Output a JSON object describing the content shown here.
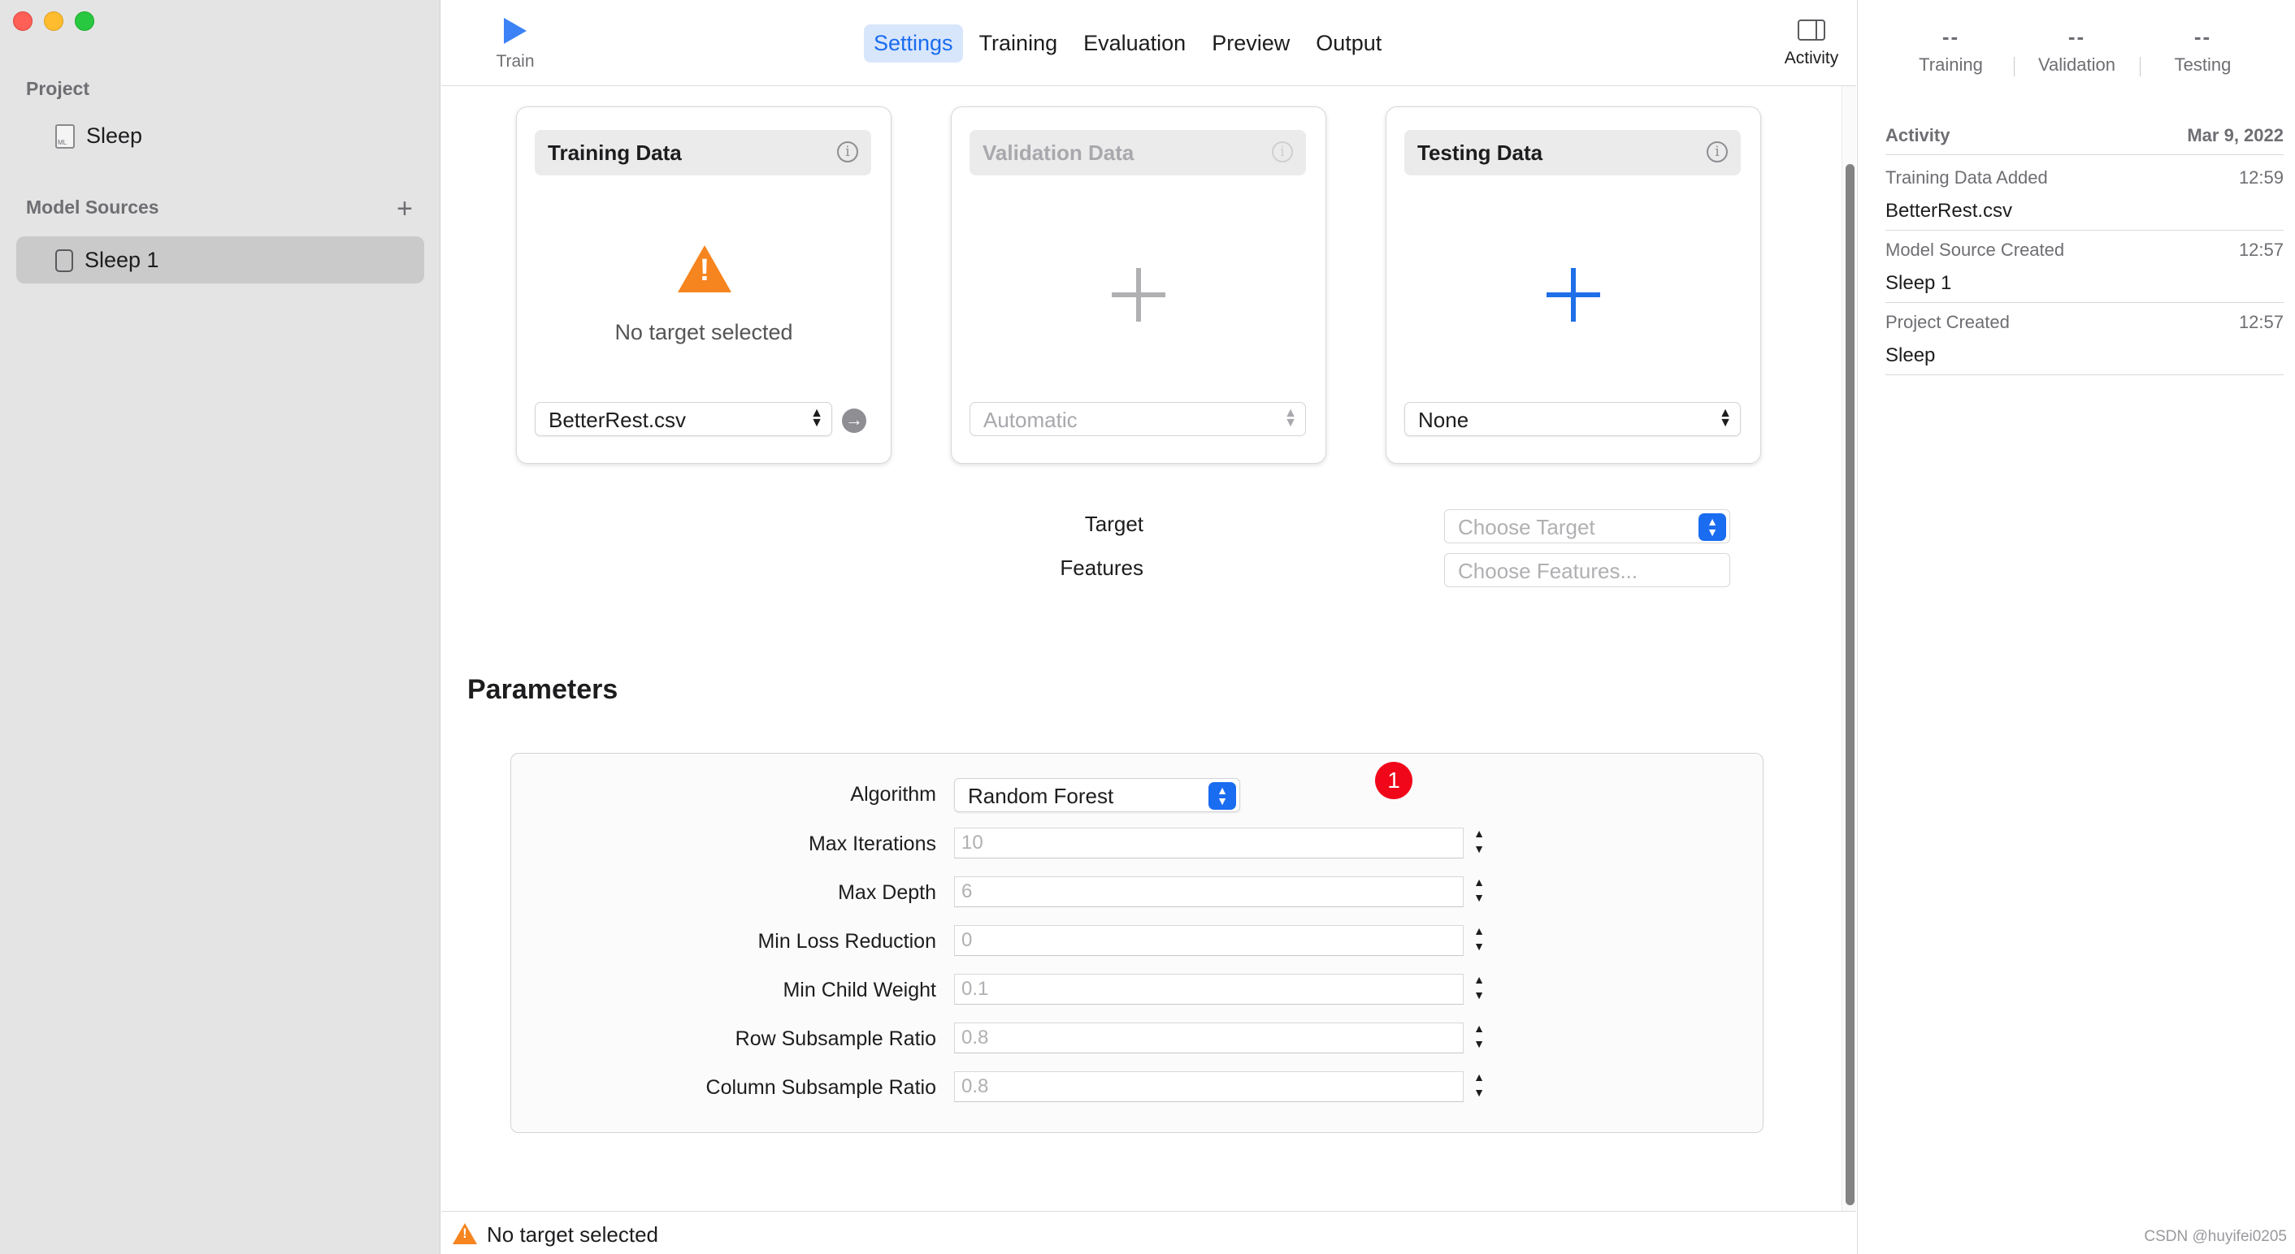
{
  "sidebar": {
    "project_header": "Project",
    "project_item": "Sleep",
    "model_sources_header": "Model Sources",
    "add_symbol": "+",
    "model_source_item": "Sleep 1"
  },
  "toolbar": {
    "train_label": "Train",
    "tabs": [
      {
        "label": "Settings",
        "active": true
      },
      {
        "label": "Training",
        "active": false
      },
      {
        "label": "Evaluation",
        "active": false
      },
      {
        "label": "Preview",
        "active": false
      },
      {
        "label": "Output",
        "active": false
      }
    ],
    "activity_label": "Activity"
  },
  "data_cards": {
    "training": {
      "title": "Training Data",
      "message": "No target selected",
      "selection": "BetterRest.csv",
      "info": "i",
      "go": "→"
    },
    "validation": {
      "title": "Validation Data",
      "selection": "Automatic",
      "info": "i"
    },
    "testing": {
      "title": "Testing Data",
      "selection": "None",
      "info": "i"
    }
  },
  "target_field": {
    "label": "Target",
    "placeholder": "Choose Target"
  },
  "features_field": {
    "label": "Features",
    "placeholder": "Choose Features..."
  },
  "parameters": {
    "title": "Parameters",
    "algorithm_label": "Algorithm",
    "algorithm_value": "Random Forest",
    "badge": "1",
    "rows": [
      {
        "label": "Max Iterations",
        "value": "10"
      },
      {
        "label": "Max Depth",
        "value": "6"
      },
      {
        "label": "Min Loss Reduction",
        "value": "0"
      },
      {
        "label": "Min Child Weight",
        "value": "0.1"
      },
      {
        "label": "Row Subsample Ratio",
        "value": "0.8"
      },
      {
        "label": "Column Subsample Ratio",
        "value": "0.8"
      }
    ]
  },
  "status": {
    "text": "No target selected"
  },
  "right_panel": {
    "counts": [
      {
        "value": "--",
        "label": "Training"
      },
      {
        "value": "--",
        "label": "Validation"
      },
      {
        "value": "--",
        "label": "Testing"
      }
    ],
    "activity_header": "Activity",
    "activity_date": "Mar 9, 2022",
    "items": [
      {
        "title": "Training Data Added",
        "time": "12:59",
        "value": "BetterRest.csv"
      },
      {
        "title": "Model Source Created",
        "time": "12:57",
        "value": "Sleep 1"
      },
      {
        "title": "Project Created",
        "time": "12:57",
        "value": "Sleep"
      }
    ]
  },
  "watermark": "CSDN @huyifei0205",
  "colors": {
    "accent": "#1a6cf0",
    "warning": "#f6841f",
    "badge": "#f0081a"
  }
}
